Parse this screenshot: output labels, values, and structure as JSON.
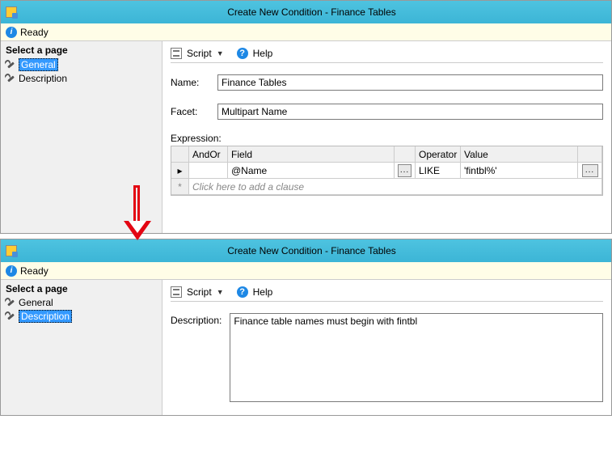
{
  "window1": {
    "title": "Create New Condition - Finance Tables",
    "status": "Ready",
    "sidebar": {
      "header": "Select a page",
      "items": [
        {
          "label": "General",
          "selected": true
        },
        {
          "label": "Description",
          "selected": false
        }
      ]
    },
    "toolbar": {
      "script": "Script",
      "help": "Help"
    },
    "form": {
      "name_label": "Name:",
      "name_value": "Finance Tables",
      "facet_label": "Facet:",
      "facet_value": "Multipart Name",
      "expression_label": "Expression:"
    },
    "grid": {
      "headers": {
        "andor": "AndOr",
        "field": "Field",
        "operator": "Operator",
        "value": "Value"
      },
      "rows": [
        {
          "andor": "",
          "field": "@Name",
          "operator": "LIKE",
          "value": "'fintbl%'"
        }
      ],
      "placeholder": "Click here to add a clause",
      "row_marker": "▸",
      "new_row_marker": "*",
      "dots": "..."
    }
  },
  "window2": {
    "title": "Create New Condition - Finance Tables",
    "status": "Ready",
    "sidebar": {
      "header": "Select a page",
      "items": [
        {
          "label": "General",
          "selected": false
        },
        {
          "label": "Description",
          "selected": true
        }
      ]
    },
    "toolbar": {
      "script": "Script",
      "help": "Help"
    },
    "form": {
      "description_label": "Description:",
      "description_value": "Finance table names must begin with fintbl"
    }
  }
}
